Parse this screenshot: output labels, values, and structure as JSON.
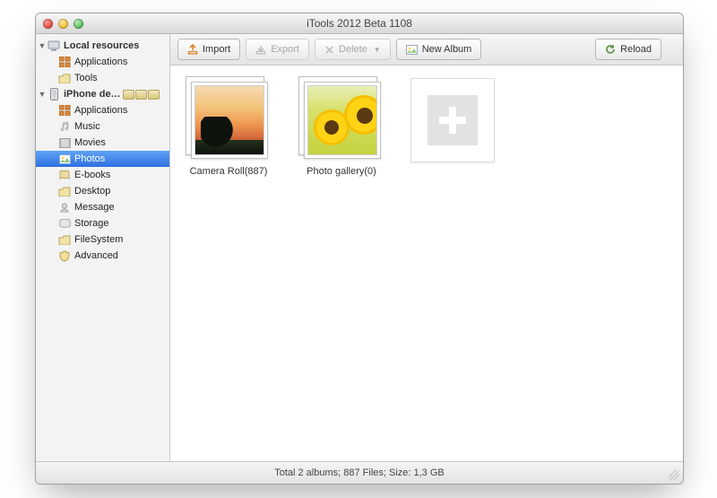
{
  "window": {
    "title": "iTools 2012 Beta 1108"
  },
  "sidebar": {
    "sections": [
      {
        "label": "Local resources",
        "icon": "computer-icon",
        "items": [
          {
            "label": "Applications",
            "icon": "apps-icon"
          },
          {
            "label": "Tools",
            "icon": "folder-icon"
          }
        ]
      },
      {
        "label": "iPhone de…",
        "icon": "iphone-icon",
        "badges": true,
        "items": [
          {
            "label": "Applications",
            "icon": "apps-icon"
          },
          {
            "label": "Music",
            "icon": "music-icon"
          },
          {
            "label": "Movies",
            "icon": "movies-icon"
          },
          {
            "label": "Photos",
            "icon": "photos-icon",
            "selected": true
          },
          {
            "label": "E-books",
            "icon": "ebooks-icon"
          },
          {
            "label": "Desktop",
            "icon": "desktop-icon"
          },
          {
            "label": "Message",
            "icon": "message-icon"
          },
          {
            "label": "Storage",
            "icon": "storage-icon"
          },
          {
            "label": "FileSystem",
            "icon": "filesystem-icon"
          },
          {
            "label": "Advanced",
            "icon": "advanced-icon"
          }
        ]
      }
    ]
  },
  "toolbar": {
    "import": {
      "label": "Import",
      "enabled": true
    },
    "export": {
      "label": "Export",
      "enabled": false
    },
    "delete": {
      "label": "Delete",
      "enabled": false,
      "dropdown": true
    },
    "new_album": {
      "label": "New Album",
      "enabled": true
    },
    "reload": {
      "label": "Reload",
      "enabled": true
    }
  },
  "albums": [
    {
      "label": "Camera Roll(887)",
      "kind": "sunset"
    },
    {
      "label": "Photo gallery(0)",
      "kind": "sunflowers"
    }
  ],
  "status": {
    "text": "Total 2 albums; 887 Files;  Size: 1,3 GB"
  }
}
